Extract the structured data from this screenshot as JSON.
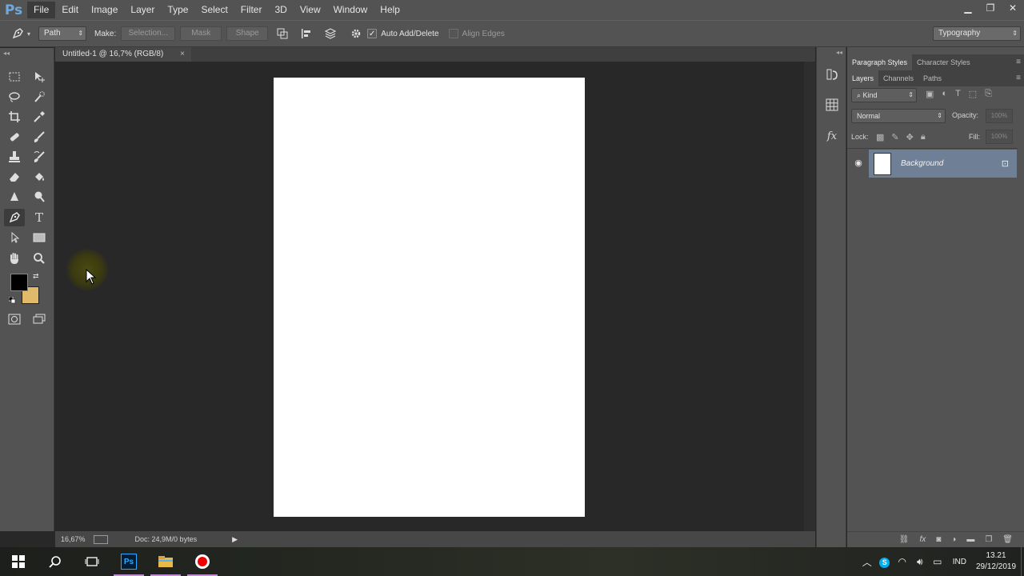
{
  "app": {
    "logo": "Ps"
  },
  "menu": [
    "File",
    "Edit",
    "Image",
    "Layer",
    "Type",
    "Select",
    "Filter",
    "3D",
    "View",
    "Window",
    "Help"
  ],
  "window_controls": {
    "minimize": "▁",
    "restore": "❐",
    "close": "✕"
  },
  "options_bar": {
    "mode": "Path",
    "make_label": "Make:",
    "selection_btn": "Selection...",
    "mask_btn": "Mask",
    "shape_btn": "Shape",
    "auto_add_delete": "Auto Add/Delete",
    "auto_add_checked_glyph": "✓",
    "align_edges": "Align Edges",
    "workspace": "Typography"
  },
  "document": {
    "tab_title": "Untitled-1 @ 16,7% (RGB/8)",
    "tab_close": "×",
    "zoom": "16,67%",
    "doc_info": "Doc: 24,9M/0 bytes"
  },
  "panels": {
    "top_tabs": [
      "Paragraph Styles",
      "Character Styles"
    ],
    "layer_tabs": [
      "Layers",
      "Channels",
      "Paths"
    ],
    "kind_filter": "Kind",
    "blend_mode": "Normal",
    "opacity_label": "Opacity:",
    "opacity_value": "100%",
    "lock_label": "Lock:",
    "fill_label": "Fill:",
    "fill_value": "100%",
    "layers": [
      {
        "name": "Background",
        "visible": true,
        "locked": true
      }
    ]
  },
  "colors": {
    "foreground": "#000000",
    "background": "#e0b96a",
    "selected_layer": "#6e7f96"
  },
  "taskbar": {
    "language": "IND",
    "time": "13.21",
    "date": "29/12/2019"
  }
}
